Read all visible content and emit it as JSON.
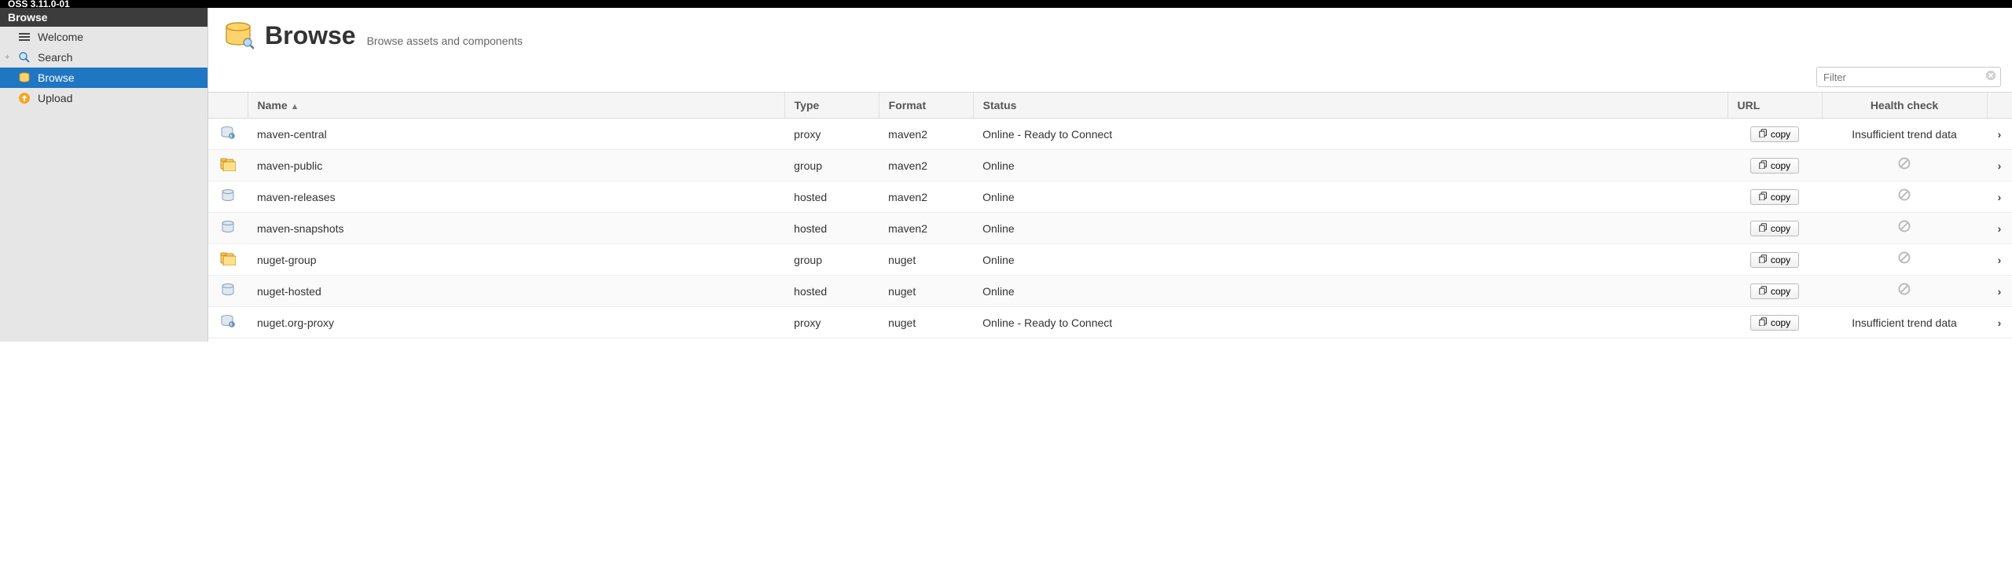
{
  "topbar": {
    "version": "OSS 3.11.0-01"
  },
  "sidebar": {
    "header": "Browse",
    "items": [
      {
        "label": "Welcome",
        "icon": "welcome-icon"
      },
      {
        "label": "Search",
        "icon": "search-icon",
        "expandable": true
      },
      {
        "label": "Browse",
        "icon": "browse-icon",
        "active": true
      },
      {
        "label": "Upload",
        "icon": "upload-icon"
      }
    ]
  },
  "page": {
    "title": "Browse",
    "subtitle": "Browse assets and components",
    "filter_placeholder": "Filter"
  },
  "table": {
    "columns": {
      "name": "Name",
      "type": "Type",
      "format": "Format",
      "status": "Status",
      "url": "URL",
      "health": "Health check"
    },
    "copy_label": "copy",
    "health_na": "Insufficient trend data",
    "rows": [
      {
        "name": "maven-central",
        "type": "proxy",
        "format": "maven2",
        "status": "Online - Ready to Connect",
        "health": "trend",
        "icon": "proxy"
      },
      {
        "name": "maven-public",
        "type": "group",
        "format": "maven2",
        "status": "Online",
        "health": "na",
        "icon": "group"
      },
      {
        "name": "maven-releases",
        "type": "hosted",
        "format": "maven2",
        "status": "Online",
        "health": "na",
        "icon": "hosted"
      },
      {
        "name": "maven-snapshots",
        "type": "hosted",
        "format": "maven2",
        "status": "Online",
        "health": "na",
        "icon": "hosted"
      },
      {
        "name": "nuget-group",
        "type": "group",
        "format": "nuget",
        "status": "Online",
        "health": "na",
        "icon": "group"
      },
      {
        "name": "nuget-hosted",
        "type": "hosted",
        "format": "nuget",
        "status": "Online",
        "health": "na",
        "icon": "hosted"
      },
      {
        "name": "nuget.org-proxy",
        "type": "proxy",
        "format": "nuget",
        "status": "Online - Ready to Connect",
        "health": "trend",
        "icon": "proxy"
      }
    ]
  }
}
